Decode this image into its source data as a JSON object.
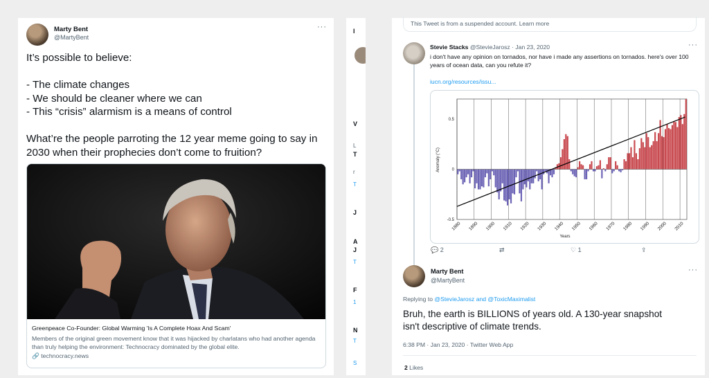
{
  "left_tweet": {
    "author": "Marty Bent",
    "handle": "@MartyBent",
    "more": "···",
    "text": "It’s possible to believe:\n\n- The climate changes\n- We should be cleaner where we can\n- This “crisis” alarmism is a means of control\n\nWhat’re the people parroting the 12 year meme going to say in\n2030 when their prophecies don’t come to fruition?",
    "card": {
      "title": "Greenpeace Co-Founder: Global Warming 'Is A Complete Hoax And Scam'",
      "description": "Members of the original green movement know that it was hijacked by charlatans who had another agenda than truly helping the environment: Technocracy dominated by the global elite.",
      "link_icon": "link-icon",
      "domain": "technocracy.news"
    }
  },
  "mid_strip": {
    "letters": [
      "I",
      "V",
      "L",
      "T",
      "r",
      "T",
      "J",
      "A",
      "J",
      "T",
      "F",
      "1",
      "N",
      "T",
      "S"
    ]
  },
  "right_thread": {
    "suspended_notice": "This Tweet is from a suspended account. Learn more",
    "reply1": {
      "author": "Stevie Stacks",
      "handle_date": "@StevieJarosz · Jan 23, 2020",
      "more": "···",
      "text": "i don't have any opinion on tornados, nor have i made any assertions on tornados.  here's over 100 years of ocean data, can you refute it?",
      "link": "iucn.org/resources/issu...",
      "actions": {
        "replies": "2",
        "retweets": "",
        "likes": "1"
      }
    },
    "reply2": {
      "author": "Marty Bent",
      "handle": "@MartyBent",
      "more": "···",
      "replying_prefix": "Replying to",
      "replying_users": "@StevieJarosz and @ToxicMaximalist",
      "text": "Bruh, the earth is BILLIONS of years old. A 130-year snapshot\nisn't descriptive of climate trends.",
      "timestamp": "6:38 PM · Jan 23, 2020 · Twitter Web App",
      "likes_count": "2",
      "likes_label": "Likes"
    }
  },
  "chart_data": {
    "type": "bar",
    "title": "",
    "xlabel": "Years",
    "ylabel": "Anomaly (°C)",
    "ylim": [
      -0.5,
      0.7
    ],
    "yticks": [
      "-0.5",
      "0",
      "0.5"
    ],
    "xticks": [
      "1880",
      "1890",
      "1900",
      "1910",
      "1920",
      "1930",
      "1940",
      "1950",
      "1960",
      "1970",
      "1980",
      "1990",
      "2000",
      "2010"
    ],
    "grid": "vertical",
    "legend": "none",
    "colors": {
      "negative": "#6b63b5",
      "positive": "#c8494f",
      "trend": "#000000"
    },
    "x_start": 1880,
    "x_end": 2013,
    "trend": [
      [
        1880,
        -0.37
      ],
      [
        2013,
        0.52
      ]
    ],
    "values": [
      -0.05,
      -0.02,
      -0.1,
      -0.15,
      -0.13,
      -0.08,
      -0.05,
      -0.14,
      -0.08,
      -0.02,
      -0.19,
      -0.14,
      -0.2,
      -0.2,
      -0.17,
      -0.18,
      -0.08,
      -0.04,
      -0.17,
      -0.1,
      -0.02,
      -0.06,
      -0.18,
      -0.23,
      -0.3,
      -0.22,
      -0.14,
      -0.31,
      -0.32,
      -0.36,
      -0.3,
      -0.34,
      -0.24,
      -0.25,
      -0.08,
      -0.02,
      -0.24,
      -0.32,
      -0.2,
      -0.15,
      -0.18,
      -0.12,
      -0.2,
      -0.14,
      -0.14,
      -0.09,
      -0.02,
      -0.12,
      -0.1,
      -0.2,
      -0.05,
      -0.02,
      -0.04,
      -0.14,
      -0.06,
      -0.08,
      -0.05,
      0.02,
      0.05,
      0.06,
      0.12,
      0.2,
      0.3,
      0.35,
      0.33,
      0.1,
      -0.02,
      -0.05,
      -0.07,
      -0.08,
      0.02,
      0.08,
      0.05,
      0.04,
      -0.1,
      -0.1,
      -0.02,
      0.05,
      0.08,
      -0.02,
      -0.02,
      0.03,
      0.04,
      0.09,
      -0.09,
      0.01,
      -0.02,
      0.05,
      0.12,
      0.12,
      -0.04,
      -0.02,
      0.08,
      0.04,
      -0.02,
      -0.03,
      -0.01,
      0.1,
      0.08,
      0.16,
      0.16,
      0.22,
      0.12,
      0.29,
      0.16,
      0.1,
      0.21,
      0.31,
      0.27,
      0.22,
      0.36,
      0.32,
      0.22,
      0.24,
      0.28,
      0.37,
      0.28,
      0.36,
      0.49,
      0.33,
      0.32,
      0.4,
      0.45,
      0.41,
      0.4,
      0.44,
      0.48,
      0.47,
      0.42,
      0.52,
      0.54,
      0.45,
      0.55,
      0.7
    ]
  }
}
